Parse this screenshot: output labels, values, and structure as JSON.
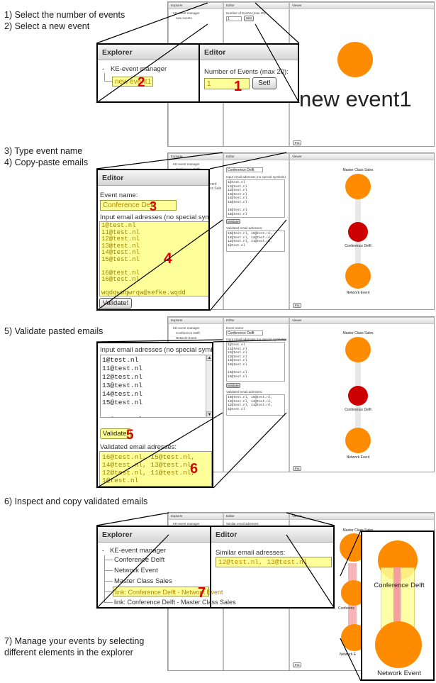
{
  "steps": {
    "s1": "1) Select the number of events",
    "s2": "2) Select a new event",
    "s3": "3) Type event name",
    "s4": "4) Copy-paste emails",
    "s5": "5) Validate pasted emails",
    "s6": "6) Inspect and copy validated emails",
    "s7a": "7) Manage your events by selecting",
    "s7b": "different elements in the explorer"
  },
  "app": {
    "explorer_title": "Explorer",
    "editor_title": "Editor",
    "viewer_title": "Viewer",
    "fix_label": "Fix",
    "root": "KE-event manager",
    "root_dash": "-"
  },
  "shot1": {
    "tree_item": "new event1",
    "num_events_label": "Number of Events (max 20):",
    "num_events_value": "1",
    "set_button": "Set!",
    "node_label": "new event1",
    "badges": {
      "b1": "1",
      "b2": "2"
    }
  },
  "shot2": {
    "tree_items": [
      "Conference Delft",
      "Network Event",
      "Master Class Sales"
    ],
    "event_name_label": "Event name:",
    "event_name_value": "Conference Delft",
    "emails_label": "Input email adresses (no special symbols):",
    "emails_text": "1@test.nl\n11@test.nl\n12@test.nl\n13@test.nl\n14@test.nl\n15@test.nl\n\n16@test.nl\n16@test.nl\n\nwqdqwdqwrqw@sefke.wqdd",
    "validate_button": "Validate!",
    "validated_label": "Validated email adresses:",
    "validated_text": "16@test.nl, 15@test.nl,\n14@test.nl, 13@test.nl,\n12@test.nl, 11@test.nl,\n1@test.nl",
    "nodes": {
      "top": "Master Class Sales",
      "mid": "Conference Delft",
      "bottom": "Network Event"
    },
    "badges": {
      "b3": "3",
      "b4": "4"
    },
    "zoom_tree_frag": [
      "vent",
      "ss Sale"
    ]
  },
  "shot3": {
    "badges": {
      "b5": "5",
      "b6": "6"
    }
  },
  "shot4": {
    "tree_items": [
      "Conference Delft",
      "Network Event",
      "Master Class Sales",
      "link: Conference Delft - Network Event",
      "link: Conference Delft - Master Class Sales"
    ],
    "similar_label": "Similar email adresses:",
    "similar_text": "12@test.nl, 13@test.nl",
    "viewer_top_label": "Master Class Sales",
    "zoom_top_label": "Conference Delft",
    "zoom_bottom_label": "Network Event",
    "viewer_mid_frag": "Conferenc",
    "viewer_bottom_frag": "Network E",
    "badges": {
      "b7": "7"
    }
  },
  "colors": {
    "highlight": "#ffff99",
    "accent_red": "#e00000",
    "node_orange": "#ff8c00",
    "node_red": "#cc0000"
  }
}
